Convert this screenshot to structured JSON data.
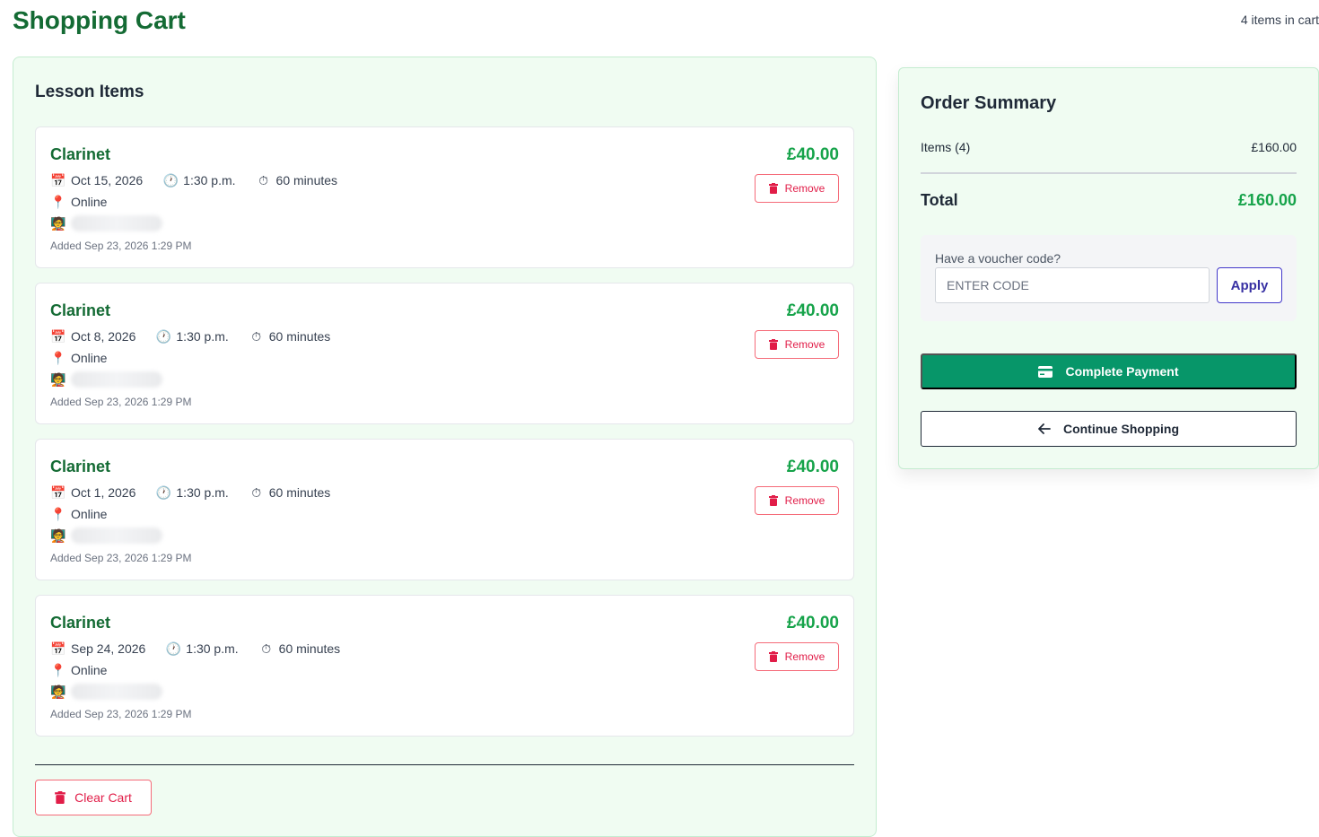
{
  "header": {
    "title": "Shopping Cart",
    "item_count": "4 items in cart"
  },
  "lessons": {
    "title": "Lesson Items",
    "items": [
      {
        "name": "Clarinet",
        "date": "Oct 15, 2026",
        "time": "1:30 p.m.",
        "duration": "60 minutes",
        "location": "Online",
        "added": "Added Sep 23, 2026 1:29 PM",
        "price": "£40.00",
        "remove_label": "Remove"
      },
      {
        "name": "Clarinet",
        "date": "Oct 8, 2026",
        "time": "1:30 p.m.",
        "duration": "60 minutes",
        "location": "Online",
        "added": "Added Sep 23, 2026 1:29 PM",
        "price": "£40.00",
        "remove_label": "Remove"
      },
      {
        "name": "Clarinet",
        "date": "Oct 1, 2026",
        "time": "1:30 p.m.",
        "duration": "60 minutes",
        "location": "Online",
        "added": "Added Sep 23, 2026 1:29 PM",
        "price": "£40.00",
        "remove_label": "Remove"
      },
      {
        "name": "Clarinet",
        "date": "Sep 24, 2026",
        "time": "1:30 p.m.",
        "duration": "60 minutes",
        "location": "Online",
        "added": "Added Sep 23, 2026 1:29 PM",
        "price": "£40.00",
        "remove_label": "Remove"
      }
    ],
    "clear_label": "Clear Cart"
  },
  "summary": {
    "title": "Order Summary",
    "items_label": "Items (4)",
    "items_value": "£160.00",
    "total_label": "Total",
    "total_value": "£160.00",
    "voucher_label": "Have a voucher code?",
    "voucher_placeholder": "ENTER CODE",
    "apply_label": "Apply",
    "pay_label": "Complete Payment",
    "continue_label": "Continue Shopping"
  },
  "icons": {
    "calendar": "calendar-icon",
    "clock": "clock-icon",
    "stopwatch": "stopwatch-icon",
    "pin": "location-pin-icon",
    "teacher": "teacher-icon",
    "trash": "trash-icon",
    "card": "credit-card-icon",
    "arrow": "arrow-left-icon"
  },
  "colors": {
    "brand_green": "#146b34",
    "price_green": "#16a34a",
    "pay_button": "#079669",
    "remove_red": "#e11d48",
    "apply_indigo": "#3730a3",
    "panel_bg": "#f0fcf2"
  }
}
